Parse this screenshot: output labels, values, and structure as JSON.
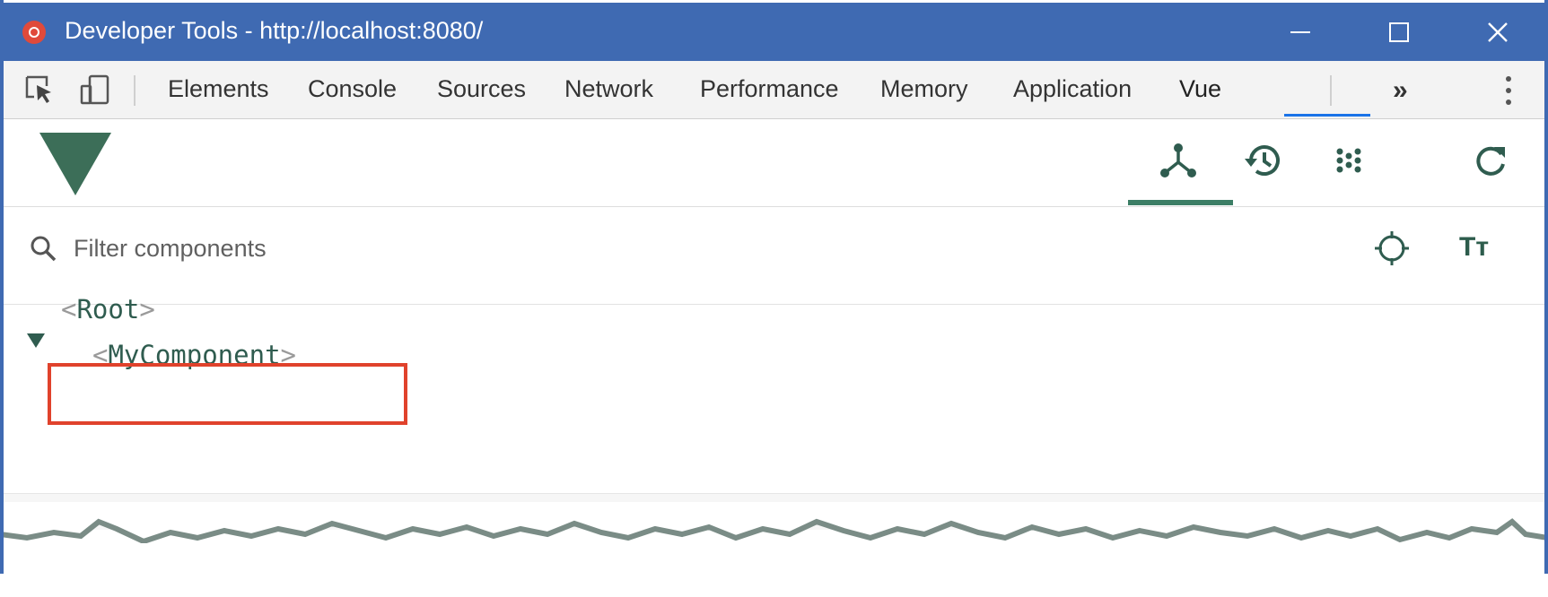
{
  "window": {
    "title": "Developer Tools - http://localhost:8080/",
    "app_icon": "chrome-devtools-icon",
    "controls": [
      "minimize-icon",
      "maximize-icon",
      "close-icon"
    ]
  },
  "devtools": {
    "tool_icons": [
      "inspect-element-icon",
      "device-toolbar-icon"
    ],
    "tabs": [
      {
        "label": "Elements"
      },
      {
        "label": "Console"
      },
      {
        "label": "Sources"
      },
      {
        "label": "Network"
      },
      {
        "label": "Performance"
      },
      {
        "label": "Memory"
      },
      {
        "label": "Application"
      },
      {
        "label": "Vue",
        "active": true
      }
    ],
    "more_tabs": "»",
    "menu_icon": "kebab-menu-icon",
    "accent_color": "#1a73e8"
  },
  "vue": {
    "logo": "vue-logo",
    "brand_color": "#3c7e65",
    "tools": [
      {
        "icon": "components-tree-icon",
        "active": true
      },
      {
        "icon": "timeline-history-icon"
      },
      {
        "icon": "performance-dots-icon"
      },
      {
        "icon": "refresh-icon"
      }
    ],
    "filter": {
      "placeholder": "Filter components",
      "value": ""
    },
    "filter_tools": [
      "select-component-target-icon",
      "text-size-icon"
    ],
    "text_size_label": "Tт",
    "tree": [
      {
        "open": "<",
        "name": "Root",
        "close": ">",
        "expanded": true
      },
      {
        "open": "<",
        "name": "MyComponent",
        "close": ">",
        "highlighted": true
      }
    ],
    "highlight_color": "#e0422c"
  }
}
